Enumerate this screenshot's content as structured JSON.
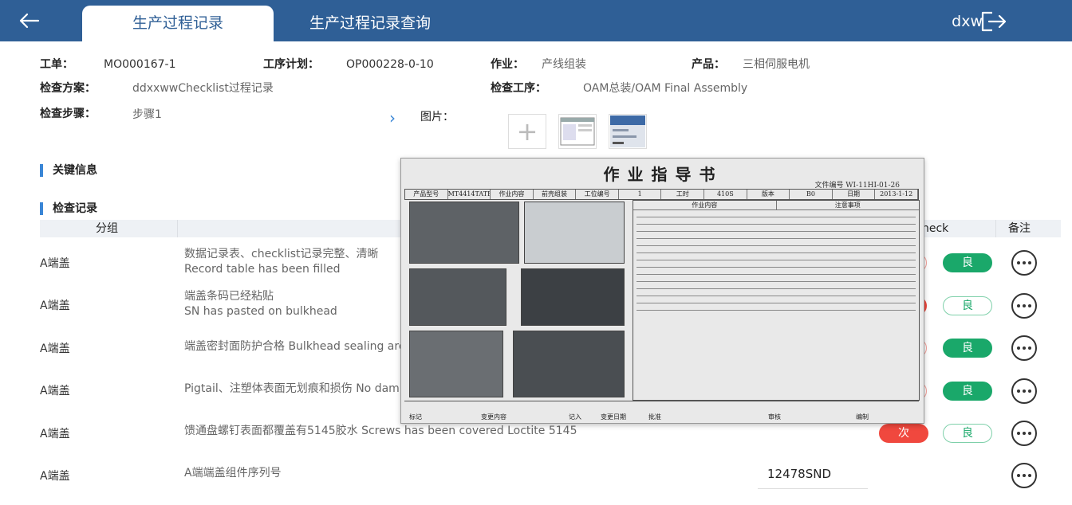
{
  "header": {
    "tabs": [
      {
        "label": "生产过程记录",
        "active": true
      },
      {
        "label": "生产过程记录查询",
        "active": false
      }
    ],
    "user": "dxw",
    "colors": {
      "header_bg": "#2f5f96",
      "accent": "#3a86d6",
      "good": "#1aa86a",
      "bad": "#f0483e"
    }
  },
  "info": {
    "work_order": {
      "label": "工单：",
      "value": "MO000167-1"
    },
    "process_plan": {
      "label": "工序计划：",
      "value": "OP000228-0-10"
    },
    "operation": {
      "label": "作业：",
      "value": "产线组装"
    },
    "product": {
      "label": "产品：",
      "value": "三相伺服电机"
    },
    "scheme": {
      "label": "检查方案：",
      "value": "ddxxwwChecklist过程记录"
    },
    "inspection_process": {
      "label": "检查工序：",
      "value": "OAM总装/OAM Final Assembly"
    },
    "step": {
      "label": "检查步骤：",
      "value": "步骤1"
    },
    "images": {
      "label": "图片："
    }
  },
  "sections": {
    "key_info": "关键信息",
    "records": "检查记录"
  },
  "table": {
    "headers": {
      "group": "分组",
      "check": "heck",
      "remark": "备注"
    },
    "good_label": "良",
    "bad_label": "次",
    "rows": [
      {
        "group": "A端盖",
        "desc_cn": "数据记录表、checklist记录完整、清晰",
        "desc_en": "Record table has been filled",
        "result": "good"
      },
      {
        "group": "A端盖",
        "desc_cn": "端盖条码已经粘贴",
        "desc_en": "SN has pasted on bulkhead",
        "result": "bad"
      },
      {
        "group": "A端盖",
        "desc_cn": "端盖密封面防护合格 Bulkhead sealing are",
        "desc_en": "",
        "result": "good"
      },
      {
        "group": "A端盖",
        "desc_cn": "Pigtail、注塑体表面无划痕和损伤 No dam",
        "desc_en": "",
        "result": "good"
      },
      {
        "group": "A端盖",
        "desc_cn": "馈通盘螺钉表面都覆盖有5145胶水 Screws has been covered Loctite 5145",
        "desc_en": "",
        "result": "bad"
      },
      {
        "group": "A端盖",
        "desc_cn": "A端端盖组件序列号",
        "desc_en": "",
        "result": "serial",
        "serial": "12478SND"
      }
    ]
  },
  "overlay": {
    "title": "作业指导书",
    "doc_no": "文件编号  WI-11HI-01-26",
    "meta": [
      "产品型号",
      "MT4414TATE",
      "作业内容",
      "前壳组装",
      "工位编号",
      "1",
      "工时",
      "410S",
      "版本",
      "B0",
      "日期",
      "2013-1-12"
    ],
    "content_header": "作业内容",
    "notes_header": "注意事项",
    "bottom": [
      "标记",
      "变更内容",
      "记入",
      "变更日期",
      "批准",
      "审核",
      "编制"
    ]
  }
}
